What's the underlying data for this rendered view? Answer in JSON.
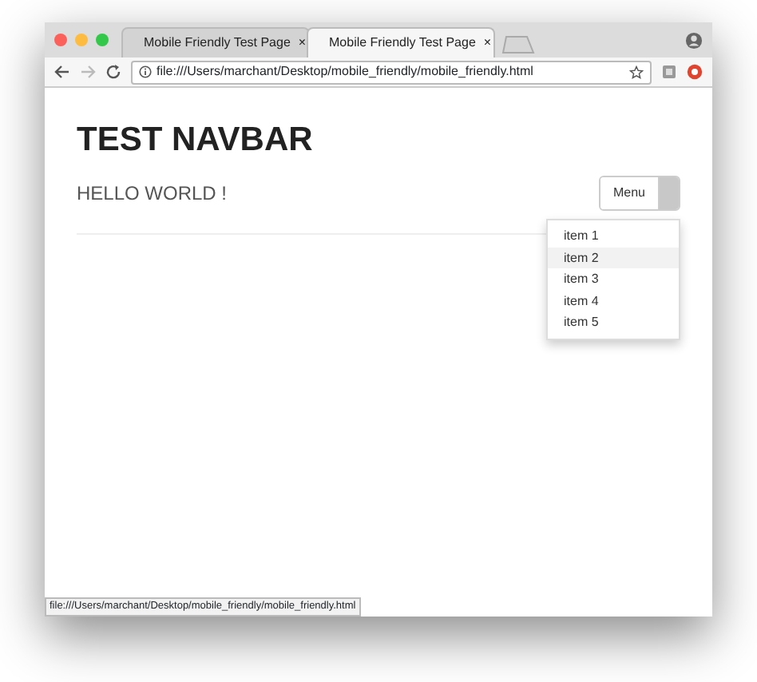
{
  "window": {
    "tabs": [
      {
        "title": "Mobile Friendly Test Page",
        "close": "×",
        "selected": false
      },
      {
        "title": "Mobile Friendly Test Page",
        "close": "×",
        "selected": true
      }
    ],
    "address": "file:///Users/marchant/Desktop/mobile_friendly/mobile_friendly.html"
  },
  "page": {
    "heading": "TEST NAVBAR",
    "subheading": "HELLO WORLD !",
    "menu": {
      "label": "Menu",
      "expanded": true,
      "items": [
        {
          "label": "item 1",
          "selected": false
        },
        {
          "label": "item 2",
          "selected": true
        },
        {
          "label": "item 3",
          "selected": false
        },
        {
          "label": "item 4",
          "selected": false
        },
        {
          "label": "item 5",
          "selected": false
        }
      ]
    }
  },
  "status_bar": "file:///Users/marchant/Desktop/mobile_friendly/mobile_friendly.html"
}
